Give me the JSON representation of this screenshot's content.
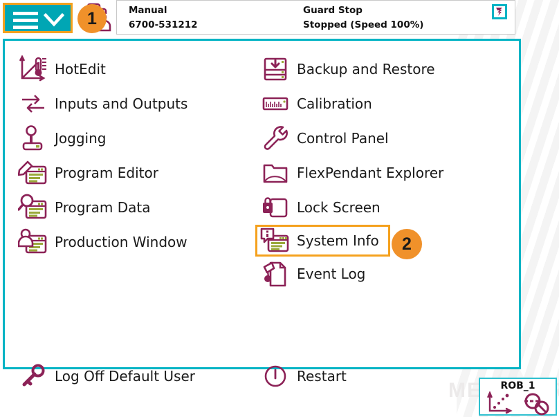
{
  "theme": {
    "teal": "#00b3c4",
    "teal_button": "#00a6b4",
    "orange": "#f0912a",
    "icon_purple": "#8c2257",
    "icon_olive": "#9aa83a",
    "text": "#1a1a1a"
  },
  "watermark": {
    "text": "MEGA MIRO"
  },
  "header": {
    "menu_button": {
      "name": "main-menu",
      "icon": "hamburger-chevron-down-icon"
    },
    "operator_icon": "robot-operator-icon",
    "left_column": {
      "mode": "Manual",
      "controller_id": "6700-531212"
    },
    "right_column": {
      "status": "Guard Stop",
      "detail": "Stopped (Speed 100%)"
    },
    "task_icon": "program-task-icon"
  },
  "badges": [
    {
      "id": "1",
      "label": "1",
      "target": "main-menu-button"
    },
    {
      "id": "2",
      "label": "2",
      "target": "system-info-item"
    }
  ],
  "menu": {
    "left_items": [
      {
        "label": "HotEdit",
        "icon": "hotedit-icon"
      },
      {
        "label": "Inputs and Outputs",
        "icon": "inputs-outputs-icon"
      },
      {
        "label": "Jogging",
        "icon": "joystick-icon"
      },
      {
        "label": "Program Editor",
        "icon": "program-editor-icon"
      },
      {
        "label": "Program Data",
        "icon": "program-data-icon"
      },
      {
        "label": "Production Window",
        "icon": "production-window-icon"
      }
    ],
    "right_items": [
      {
        "label": "Backup and Restore",
        "icon": "backup-restore-icon",
        "highlighted": false
      },
      {
        "label": "Calibration",
        "icon": "calibration-icon",
        "highlighted": false
      },
      {
        "label": "Control Panel",
        "icon": "wrench-icon",
        "highlighted": false
      },
      {
        "label": "FlexPendant Explorer",
        "icon": "folder-icon",
        "highlighted": false
      },
      {
        "label": "Lock Screen",
        "icon": "lock-screen-icon",
        "highlighted": false
      },
      {
        "label": "System Info",
        "icon": "system-info-icon",
        "highlighted": true
      },
      {
        "label": "Event Log",
        "icon": "event-log-icon",
        "highlighted": false
      }
    ],
    "bottom_items": [
      {
        "label": "Log Off Default User",
        "icon": "key-icon"
      },
      {
        "label": "Restart",
        "icon": "power-restart-icon"
      }
    ]
  },
  "status_widget": {
    "title": "ROB_1",
    "axis_icon": "coordinate-axis-icon",
    "motors_icon": "motors-off-icon"
  }
}
